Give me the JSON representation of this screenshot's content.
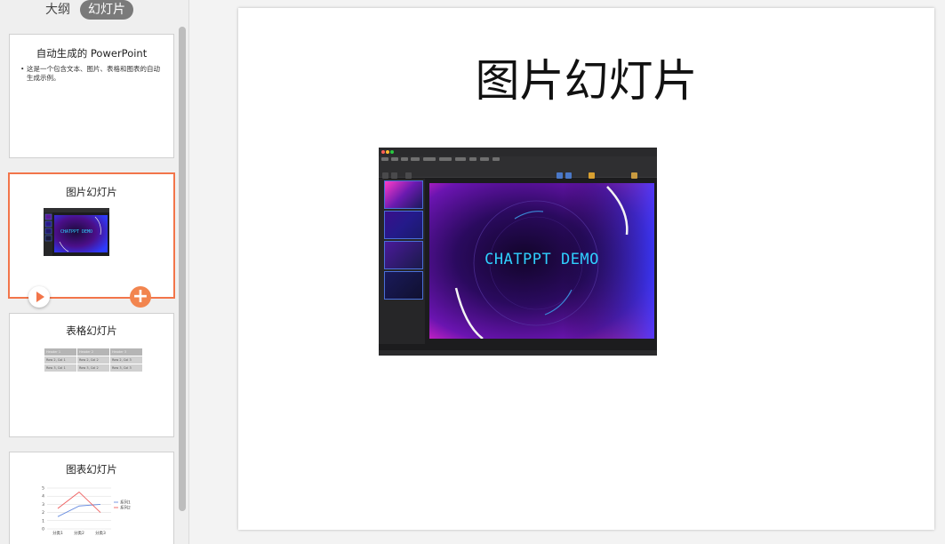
{
  "tabs": {
    "outline": "大纲",
    "slides": "幻灯片",
    "active": "slides"
  },
  "thumbnails": [
    {
      "index": 1,
      "title": "自动生成的 PowerPoint",
      "bullet": "这是一个包含文本、图片、表格和图表的自动生成示例。"
    },
    {
      "index": 2,
      "title": "图片幻灯片",
      "image_text": "CHATPPT DEMO",
      "selected": true
    },
    {
      "index": 3,
      "title": "表格幻灯片",
      "table": [
        [
          "Header 1",
          "Header 2",
          "Header 3"
        ],
        [
          "Row 2, Col 1",
          "Row 2, Col 2",
          "Row 2, Col 3"
        ],
        [
          "Row 3, Col 1",
          "Row 3, Col 2",
          "Row 3, Col 3"
        ]
      ]
    },
    {
      "index": 4,
      "title": "图表幻灯片"
    }
  ],
  "chart_data": {
    "type": "line",
    "categories": [
      "分类1",
      "分类2",
      "分类3"
    ],
    "series": [
      {
        "name": "系列1",
        "values": [
          1.5,
          2.8,
          3.0
        ],
        "color": "#6a8ee0"
      },
      {
        "name": "系列2",
        "values": [
          2.5,
          4.5,
          2.0
        ],
        "color": "#ef5f5f"
      }
    ],
    "ylim": [
      0,
      5
    ],
    "yticks": [
      "0",
      "1",
      "2",
      "3",
      "4",
      "5"
    ],
    "grid": true,
    "legend": "right"
  },
  "main_slide": {
    "title": "图片幻灯片",
    "image_text": "CHATPPT DEMO"
  },
  "colors": {
    "selection": "#f2754a",
    "demo_text": "#2fd0ff",
    "panel_bg": "#efefef"
  },
  "icons": {
    "play": "play-icon",
    "add": "add-icon"
  }
}
